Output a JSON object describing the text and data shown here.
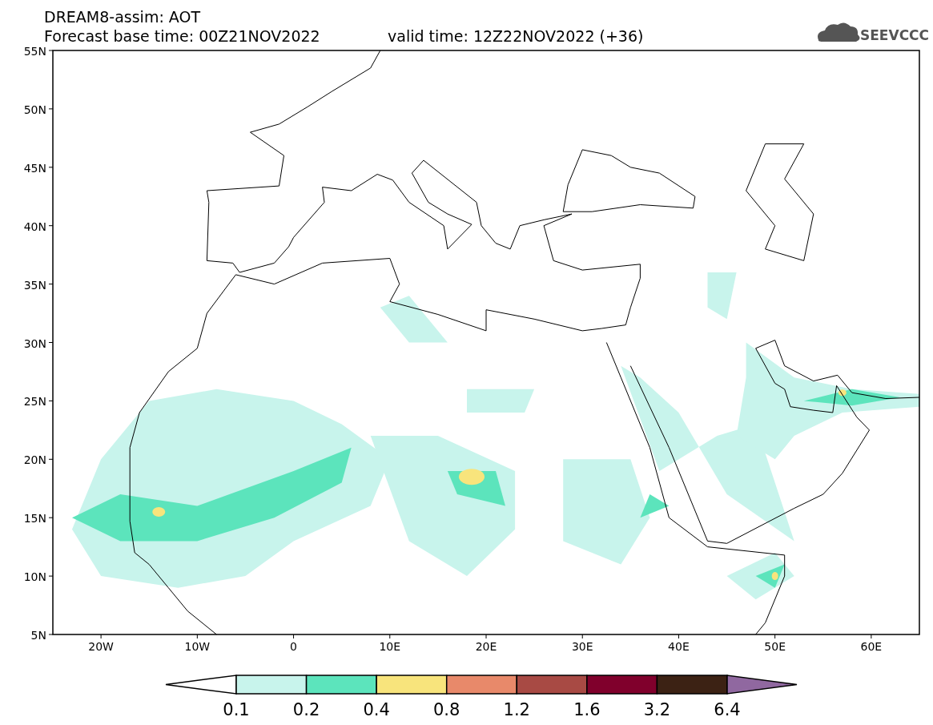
{
  "title": "DREAM8-assim: AOT",
  "base_time": "Forecast base time: 00Z21NOV2022",
  "valid_time": "valid time: 12Z22NOV2022 (+36)",
  "logo": "SEEVCCC",
  "map": {
    "lat_labels": [
      "55N",
      "50N",
      "45N",
      "40N",
      "35N",
      "30N",
      "25N",
      "20N",
      "15N",
      "10N",
      "5N"
    ],
    "lon_labels": [
      "20W",
      "10W",
      "0",
      "10E",
      "20E",
      "30E",
      "40E",
      "50E",
      "60E"
    ]
  },
  "colorbar": {
    "segments": [
      {
        "kind": "low-arrow",
        "color": "#ffffff"
      },
      {
        "kind": "swatch",
        "color": "#c8f4ec"
      },
      {
        "kind": "swatch",
        "color": "#5ce4bc"
      },
      {
        "kind": "swatch",
        "color": "#f8e47c"
      },
      {
        "kind": "swatch",
        "color": "#e8896a"
      },
      {
        "kind": "swatch",
        "color": "#a84a44"
      },
      {
        "kind": "swatch",
        "color": "#80002c"
      },
      {
        "kind": "swatch",
        "color": "#3c2214"
      },
      {
        "kind": "high-arrow",
        "color": "#9068a0"
      }
    ],
    "labels": [
      "0.1",
      "0.2",
      "0.4",
      "0.8",
      "1.2",
      "1.6",
      "3.2",
      "6.4"
    ]
  }
}
